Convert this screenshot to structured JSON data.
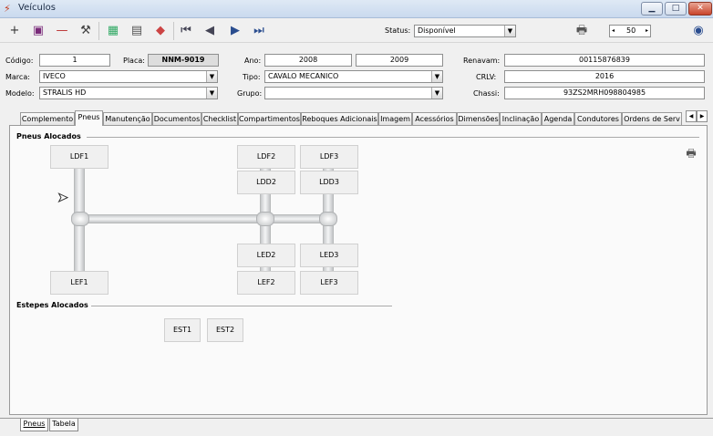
{
  "window": {
    "title": "Veículos"
  },
  "toolbar": {
    "status_label": "Status:",
    "status_value": "Disponível",
    "page_size": "50"
  },
  "form": {
    "codigo_label": "Código:",
    "codigo": "1",
    "placa_label": "Placa:",
    "placa": "NNM-9019",
    "ano_label": "Ano:",
    "ano_fab": "2008",
    "ano_mod": "2009",
    "renavam_label": "Renavam:",
    "renavam": "00115876839",
    "marca_label": "Marca:",
    "marca": "IVECO",
    "tipo_label": "Tipo:",
    "tipo": "CAVALO MECANICO",
    "crlv_label": "CRLV:",
    "crlv": "2016",
    "modelo_label": "Modelo:",
    "modelo": "STRALIS HD",
    "grupo_label": "Grupo:",
    "grupo": "",
    "chassi_label": "Chassi:",
    "chassi": "93ZS2MRH098804985"
  },
  "tabs": [
    "Complemento",
    "Pneus",
    "Manutenção",
    "Documentos",
    "Checklist",
    "Compartimentos",
    "Reboques Adicionais",
    "Imagem",
    "Acessórios",
    "Dimensões",
    "Inclinação",
    "Agenda",
    "Condutores",
    "Ordens de Serv"
  ],
  "active_tab": "Pneus",
  "pneus": {
    "alocados_title": "Pneus Alocados",
    "estepes_title": "Estepes Alocados",
    "tires": {
      "ldf1": "LDF1",
      "lef1": "LEF1",
      "ldf2": "LDF2",
      "ldd2": "LDD2",
      "led2": "LED2",
      "lef2": "LEF2",
      "ldf3": "LDF3",
      "ldd3": "LDD3",
      "led3": "LED3",
      "lef3": "LEF3"
    },
    "estepes": {
      "est1": "EST1",
      "est2": "EST2"
    }
  },
  "bottom_tabs": {
    "pneus": "Pneus",
    "tabela": "Tabela"
  },
  "icons": {
    "title": "veiculos-app-icon",
    "add": "plus-icon",
    "save": "save-icon",
    "delete": "minus-icon",
    "search": "hammer-icon",
    "print": "printer-icon",
    "globe": "globe-icon"
  }
}
